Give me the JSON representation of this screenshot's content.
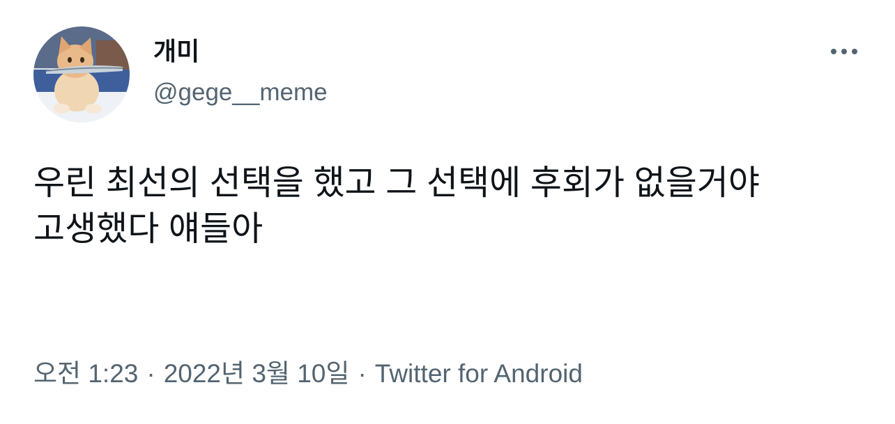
{
  "user": {
    "display_name": "개미",
    "handle": "@gege__meme",
    "avatar_icon": "cat-with-fish-avatar"
  },
  "more_icon": "more-horizontal-icon",
  "tweet": {
    "text": "우린 최선의 선택을 했고 그 선택에 후회가 없을거야\n고생했다 얘들아"
  },
  "meta": {
    "time": "오전 1:23",
    "separator": "·",
    "date": "2022년 3월 10일",
    "source": "Twitter for Android"
  },
  "colors": {
    "text_primary": "#0f1419",
    "text_secondary": "#536471",
    "background": "#ffffff"
  }
}
